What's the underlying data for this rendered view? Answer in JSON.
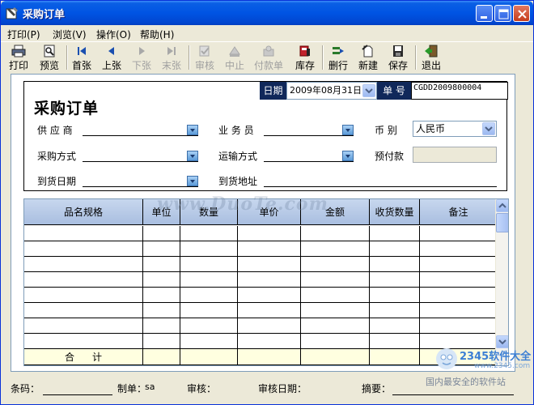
{
  "window": {
    "title": "采购订单"
  },
  "menu": [
    {
      "label": "打印(P)",
      "icon": "printer-menu"
    },
    {
      "label": "浏览(V)"
    },
    {
      "label": "操作(O)"
    },
    {
      "label": "帮助(H)"
    }
  ],
  "toolbar": {
    "print": "打印",
    "preview": "预览",
    "first": "首张",
    "prev": "上张",
    "next": "下张",
    "last": "末张",
    "audit": "审核",
    "stop": "中止",
    "payment": "付款单",
    "stock": "库存",
    "delete_row": "删行",
    "new": "新建",
    "save": "保存",
    "exit": "退出"
  },
  "header": {
    "title": "采购订单",
    "date_label": "日期",
    "date_value": "2009年08月31日",
    "order_no_label": "单 号",
    "order_no_value": "CGDD2009800004"
  },
  "fields": {
    "supplier": {
      "label": "供 应 商",
      "value": ""
    },
    "salesman": {
      "label": "业 务 员",
      "value": ""
    },
    "currency": {
      "label": "币   别",
      "value": "人民币"
    },
    "purchase_method": {
      "label": "采购方式",
      "value": ""
    },
    "transport_method": {
      "label": "运输方式",
      "value": ""
    },
    "prepayment": {
      "label": "预付款",
      "value": ""
    },
    "arrival_date": {
      "label": "到货日期",
      "value": ""
    },
    "arrival_address": {
      "label": "到货地址",
      "value": ""
    }
  },
  "grid": {
    "columns": [
      "品名规格",
      "单位",
      "数量",
      "单价",
      "金额",
      "收货数量",
      "备注"
    ],
    "rows": [
      [
        "",
        "",
        "",
        "",
        "",
        "",
        ""
      ],
      [
        "",
        "",
        "",
        "",
        "",
        "",
        ""
      ],
      [
        "",
        "",
        "",
        "",
        "",
        "",
        ""
      ],
      [
        "",
        "",
        "",
        "",
        "",
        "",
        ""
      ],
      [
        "",
        "",
        "",
        "",
        "",
        "",
        ""
      ],
      [
        "",
        "",
        "",
        "",
        "",
        "",
        ""
      ],
      [
        "",
        "",
        "",
        "",
        "",
        "",
        ""
      ],
      [
        "",
        "",
        "",
        "",
        "",
        "",
        ""
      ]
    ],
    "total_label": "合计"
  },
  "watermark": "www.DuoTe.com",
  "status": {
    "barcode_label": "条码：",
    "maker_label": "制单：",
    "maker_value": "sa",
    "auditor_label": "审核：",
    "audit_date_label": "审核日期：",
    "summary_label": "摘要："
  },
  "brand": {
    "top": "2345软件大全",
    "url": "www.2345.com",
    "bottom": "国内最安全的软件站"
  }
}
